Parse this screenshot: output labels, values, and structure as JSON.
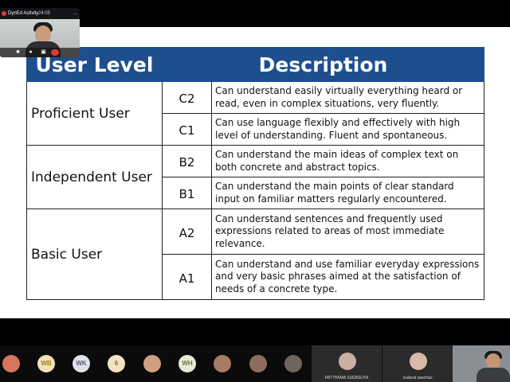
{
  "self_view": {
    "title": "DynEd Activity",
    "timer": "24:05",
    "menu": "..."
  },
  "slide": {
    "header": {
      "user_level": "User Level",
      "description": "Description"
    },
    "groups": [
      {
        "name": "Proficient User",
        "rows": [
          {
            "code": "C2",
            "description": "Can understand easily virtually everything heard or read, even in complex situations, very fluently."
          },
          {
            "code": "C1",
            "description": "Can use language flexibly and effectively with high level of understanding. Fluent and spontaneous."
          }
        ]
      },
      {
        "name": "Independent User",
        "rows": [
          {
            "code": "B2",
            "description": "Can understand the main ideas of complex text on both concrete and abstract topics."
          },
          {
            "code": "B1",
            "description": "Can understand the main points of clear standard input on familiar matters regularly encountered."
          }
        ]
      },
      {
        "name": "Basic User",
        "rows": [
          {
            "code": "A2",
            "description": "Can understand sentences and frequently used expressions related to areas of most immediate relevance."
          },
          {
            "code": "A1",
            "description": "Can understand and use familiar everyday expressions and very basic phrases aimed at the satisfaction of needs of a concrete type."
          }
        ]
      }
    ]
  },
  "participants": {
    "initials": [
      "WB",
      "WK",
      "6",
      "WH"
    ],
    "tiles": [
      {
        "name": "PATTHAMA SUEBSUYA"
      },
      {
        "name": "sudarat saechao"
      }
    ]
  },
  "colors": {
    "header_bg": "#1f4e8f",
    "end_call": "#e53935"
  }
}
